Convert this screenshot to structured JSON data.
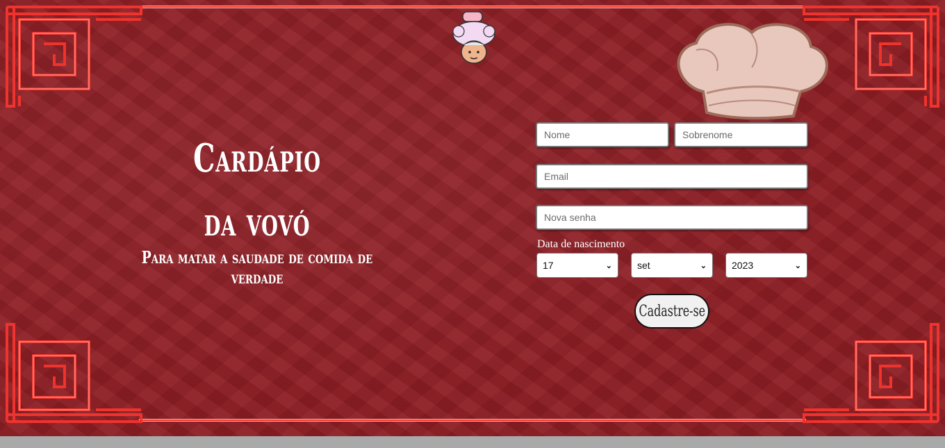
{
  "hero": {
    "title_line1": "Cardápio",
    "title_line2": "da vovó",
    "subtitle": "Para matar a saudade de comida de verdade"
  },
  "form": {
    "first_name_placeholder": "Nome",
    "last_name_placeholder": "Sobrenome",
    "email_placeholder": "Email",
    "password_placeholder": "Nova senha",
    "dob_label": "Data de nascimento",
    "day_value": "17",
    "month_value": "set",
    "year_value": "2023",
    "submit_label": "Cadastre-se"
  },
  "icons": {
    "avatar": "grandma-chef-icon",
    "chef_hat": "chef-hat-icon",
    "ornament": "chinese-fret-corner"
  },
  "colors": {
    "background": "#8d1e24",
    "frame": "#f0332c",
    "text": "#ffffff"
  }
}
